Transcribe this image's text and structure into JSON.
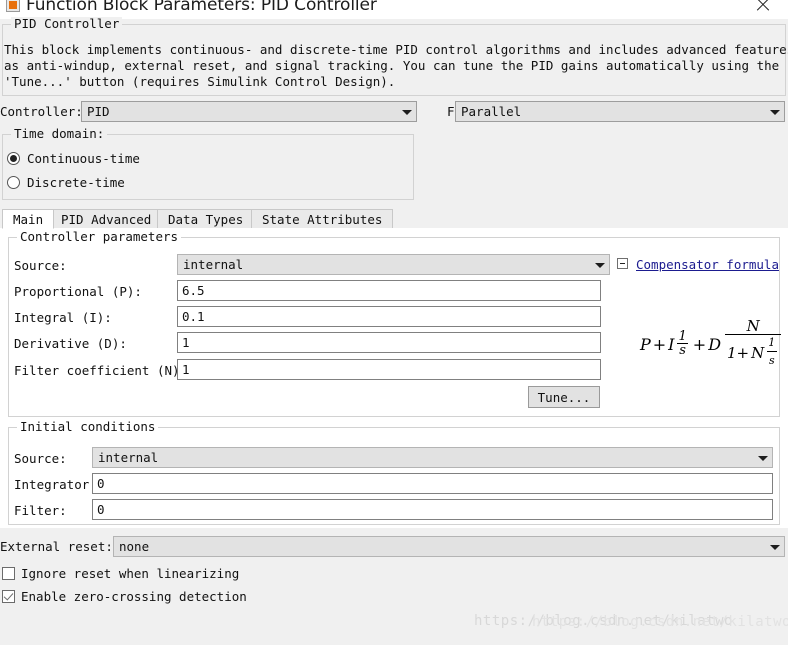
{
  "window": {
    "title": "Function Block Parameters: PID Controller",
    "icon": "simulink-block-icon",
    "close_label": "✕"
  },
  "block_group": {
    "label": "PID Controller",
    "description_line1": "This block implements continuous- and discrete-time PID control algorithms and includes advanced features such",
    "description_line2": "as anti-windup, external reset, and signal tracking. You can tune the PID gains automatically using the",
    "description_line3": "'Tune...' button (requires Simulink Control Design)."
  },
  "controller_row": {
    "controller_label": "Controller:",
    "controller_value": "PID",
    "form_label": "Form:",
    "form_value": "Parallel"
  },
  "time_domain": {
    "label": "Time domain:",
    "options": [
      {
        "label": "Continuous-time",
        "selected": true
      },
      {
        "label": "Discrete-time",
        "selected": false
      }
    ]
  },
  "tabs": [
    {
      "label": "Main",
      "active": true
    },
    {
      "label": "PID Advanced",
      "active": false
    },
    {
      "label": "Data Types",
      "active": false
    },
    {
      "label": "State Attributes",
      "active": false
    }
  ],
  "controller_parameters": {
    "group_label": "Controller parameters",
    "source_label": "Source:",
    "source_value": "internal",
    "proportional_label": "Proportional (P):",
    "proportional_value": "6.5",
    "integral_label": "Integral (I):",
    "integral_value": "0.1",
    "derivative_label": "Derivative (D):",
    "derivative_value": "1",
    "filter_coefficient_label": "Filter coefficient (N):",
    "filter_coefficient_value": "1",
    "tune_button_label": "Tune..."
  },
  "compensator": {
    "link_label": "Compensator formula",
    "expander_state": "expanded",
    "formula_text": "P + I (1/s) + D N/(1 + N (1/s))",
    "tokens": {
      "p": "P",
      "plus1": "+",
      "i": "I",
      "one_a": "1",
      "s_a": "s",
      "plus2": "+",
      "d": "D",
      "n_num": "N",
      "one_den": "1+",
      "n_den": "N",
      "one_b": "1",
      "s_b": "s"
    }
  },
  "initial_conditions": {
    "group_label": "Initial conditions",
    "source_label": "Source:",
    "source_value": "internal",
    "integrator_label": "Integrator:",
    "integrator_value": "0",
    "filter_label": "Filter:",
    "filter_value": "0"
  },
  "external_reset": {
    "label": "External reset:",
    "value": "none"
  },
  "checkboxes": [
    {
      "label": "Ignore reset when linearizing",
      "checked": false
    },
    {
      "label": "Enable zero-crossing detection",
      "checked": true
    }
  ],
  "watermark": {
    "text": "https://blog.csdn.net/kilatwo"
  }
}
